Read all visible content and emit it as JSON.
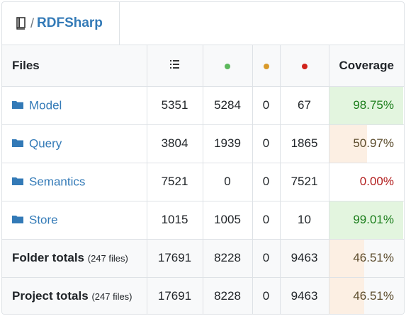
{
  "repo": {
    "name": "RDFSharp",
    "separator": "/"
  },
  "headers": {
    "files": "Files",
    "lines_icon": "lines-icon",
    "coverage": "Coverage"
  },
  "colors": {
    "covered": "#5cb85c",
    "partial": "#d99a2a",
    "missed": "#d0231b"
  },
  "rows": [
    {
      "name": "Model",
      "lines": "5351",
      "covered": "5284",
      "partial": "0",
      "missed": "67",
      "coverage": "98.75%",
      "coverage_value": 98.75
    },
    {
      "name": "Query",
      "lines": "3804",
      "covered": "1939",
      "partial": "0",
      "missed": "1865",
      "coverage": "50.97%",
      "coverage_value": 50.97
    },
    {
      "name": "Semantics",
      "lines": "7521",
      "covered": "0",
      "partial": "0",
      "missed": "7521",
      "coverage": "0.00%",
      "coverage_value": 0
    },
    {
      "name": "Store",
      "lines": "1015",
      "covered": "1005",
      "partial": "0",
      "missed": "10",
      "coverage": "99.01%",
      "coverage_value": 99.01
    }
  ],
  "totals": [
    {
      "label": "Folder totals",
      "files": "(247 files)",
      "lines": "17691",
      "covered": "8228",
      "partial": "0",
      "missed": "9463",
      "coverage": "46.51%",
      "coverage_value": 46.51
    },
    {
      "label": "Project totals",
      "files": "(247 files)",
      "lines": "17691",
      "covered": "8228",
      "partial": "0",
      "missed": "9463",
      "coverage": "46.51%",
      "coverage_value": 46.51
    }
  ]
}
